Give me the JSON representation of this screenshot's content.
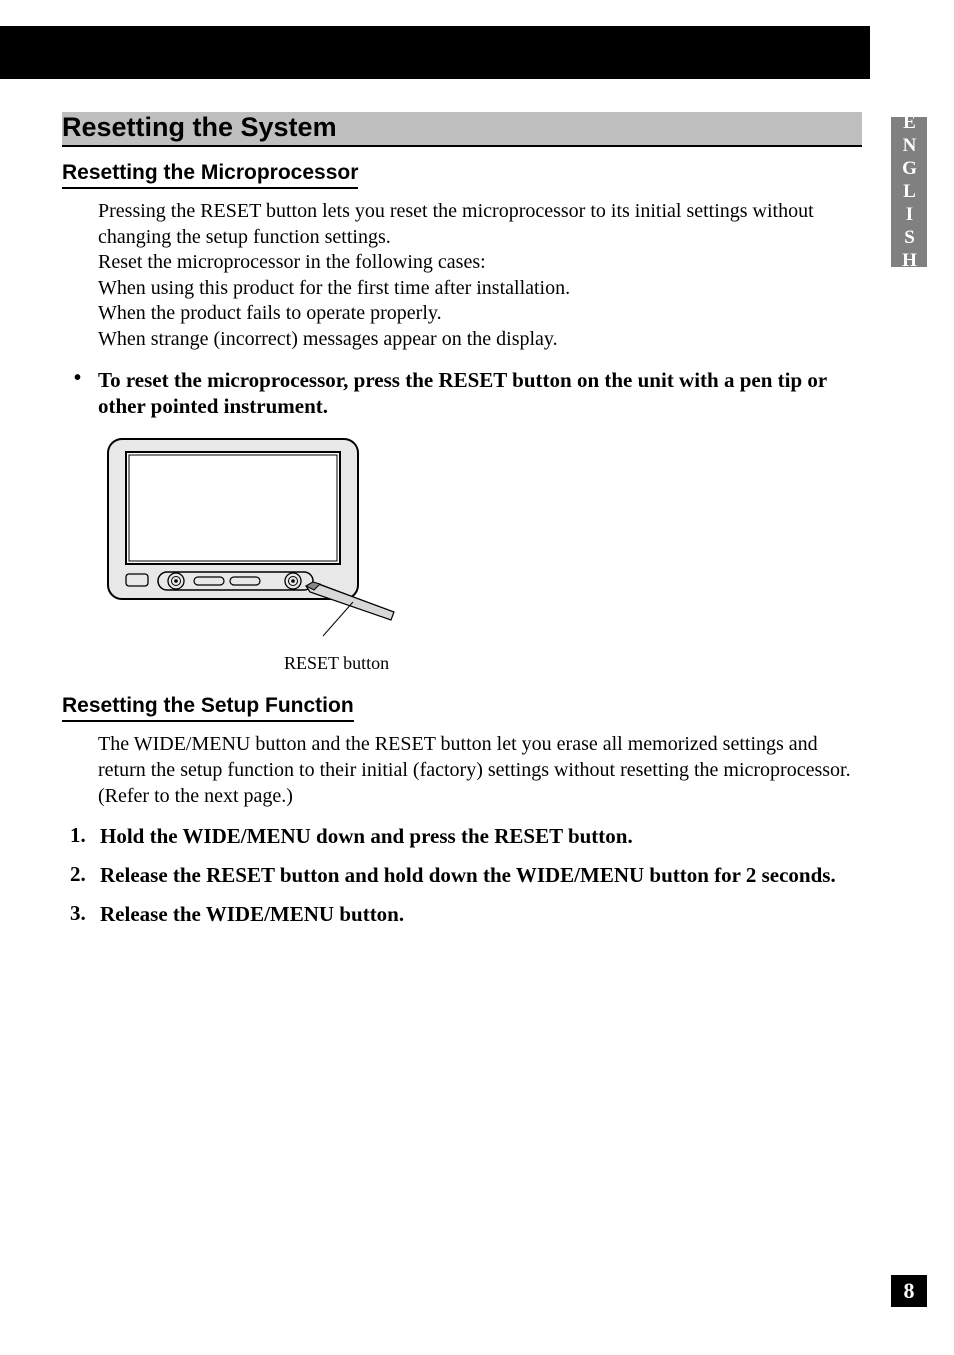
{
  "header": {
    "title": "Resetting the System"
  },
  "language_tab": "ENGLISH",
  "page_number": "8",
  "section1": {
    "heading": "Resetting the Microprocessor",
    "para": "Pressing the RESET button lets you reset the microprocessor to its initial settings without changing the setup function settings.\nReset the microprocessor in the following cases:\nWhen using this product for the first time after installation.\nWhen the product fails to operate properly.\nWhen strange (incorrect) messages appear on the display.",
    "bullet": "To reset the microprocessor, press the RESET button on the unit with a pen tip or other pointed instrument.",
    "caption": "RESET button"
  },
  "section2": {
    "heading": "Resetting the Setup Function",
    "para": "The WIDE/MENU button and the RESET button let you erase all memorized settings and return the setup function to their initial (factory) settings without resetting the microprocessor. (Refer to the next page.)",
    "steps": [
      "Hold the WIDE/MENU down and press the RESET button.",
      "Release the RESET button and hold down the WIDE/MENU button for 2 seconds.",
      "Release the WIDE/MENU button."
    ]
  }
}
